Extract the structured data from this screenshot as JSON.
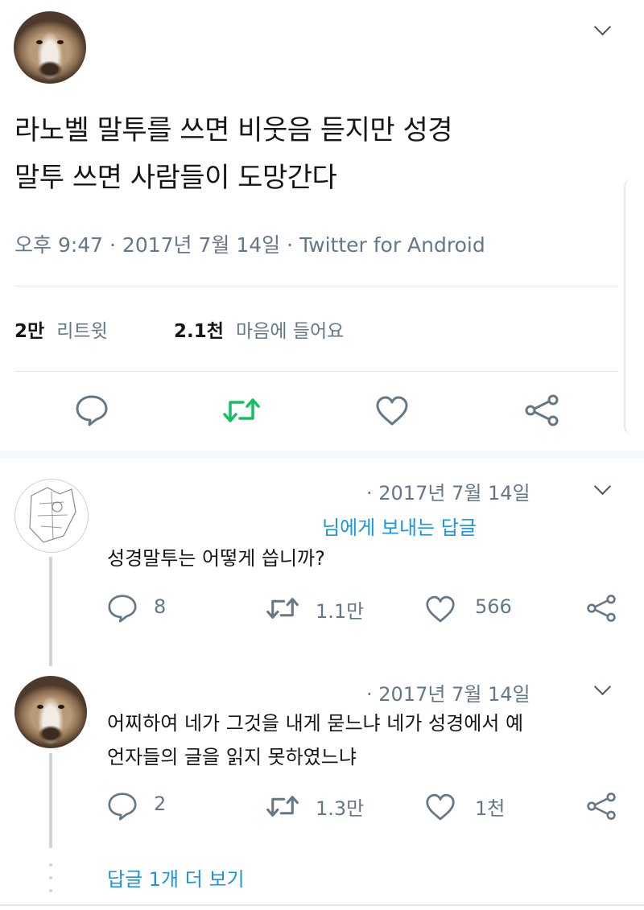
{
  "main_tweet": {
    "text_line1": "라노벨 말투를 쓰면 비웃음 듣지만 성경",
    "text_line2": "말투 쓰면 사람들이 도망간다",
    "meta": "오후 9:47 · 2017년 7월 14일 · Twitter for Android",
    "retweets_count": "2만",
    "retweets_label": "리트윗",
    "likes_count": "2.1천",
    "likes_label": "마음에 들어요",
    "accent_retweet_color": "#17bf63"
  },
  "reply1": {
    "date": "· 2017년 7월 14일",
    "replying_to": "님에게 보내는 답글",
    "text": "성경말투는 어떻게 씁니까?",
    "reply_count": "8",
    "retweet_count": "1.1만",
    "like_count": "566"
  },
  "reply2": {
    "date": "· 2017년 7월 14일",
    "text_line1": "어찌하여 네가 그것을 내게 묻느냐 네가 성경에서 예",
    "text_line2": "언자들의 글을 읽지 못하였느냐",
    "reply_count": "2",
    "retweet_count": "1.3만",
    "like_count": "1천"
  },
  "more_replies": "답글 1개 더 보기",
  "icons": [
    "chevron-down-icon",
    "reply-icon",
    "retweet-icon",
    "like-icon",
    "share-icon"
  ],
  "colors": {
    "link": "#1b95e0",
    "muted": "#657786",
    "divider": "#e1e8ed"
  }
}
